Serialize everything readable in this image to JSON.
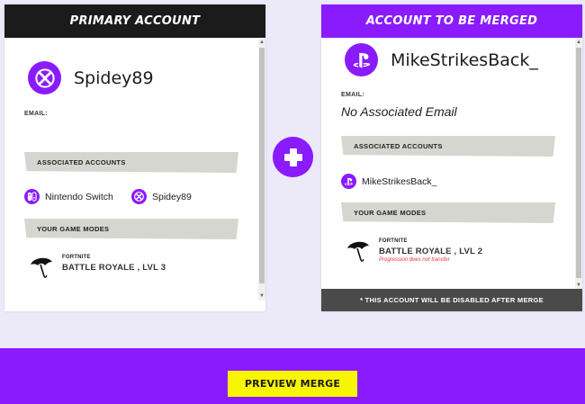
{
  "primary": {
    "header": "PRIMARY ACCOUNT",
    "platform_icon": "xbox-icon",
    "display_name": "Spidey89",
    "email_label": "EMAIL:",
    "email_value": "",
    "associated_label": "ASSOCIATED ACCOUNTS",
    "associated": [
      {
        "icon": "nintendo-switch-icon",
        "label": "Nintendo Switch"
      },
      {
        "icon": "xbox-icon",
        "label": "Spidey89"
      }
    ],
    "gamemodes_label": "YOUR GAME MODES",
    "gamemode": {
      "icon": "umbrella-icon",
      "title": "FORTNITE",
      "mode": "BATTLE ROYALE , LVL 3"
    }
  },
  "merged": {
    "header": "ACCOUNT TO BE MERGED",
    "platform_icon": "playstation-icon",
    "display_name": "MikeStrikesBack_",
    "email_label": "EMAIL:",
    "email_value": "No Associated Email",
    "associated_label": "ASSOCIATED ACCOUNTS",
    "associated": [
      {
        "icon": "playstation-icon",
        "label": "MikeStrikesBack_"
      }
    ],
    "gamemodes_label": "YOUR GAME MODES",
    "gamemode": {
      "icon": "umbrella-icon",
      "title": "FORTNITE",
      "mode": "BATTLE ROYALE , LVL 2",
      "note": "Progression does not transfer"
    },
    "disable_notice": "* THIS ACCOUNT WILL BE DISABLED AFTER MERGE"
  },
  "plus_icon": "plus-icon",
  "preview_button": "PREVIEW MERGE",
  "colors": {
    "accent": "#8a1bff",
    "dark": "#1b1b1b",
    "button": "#f8f500",
    "band": "#d6d6d0",
    "note": "#e8343b"
  }
}
